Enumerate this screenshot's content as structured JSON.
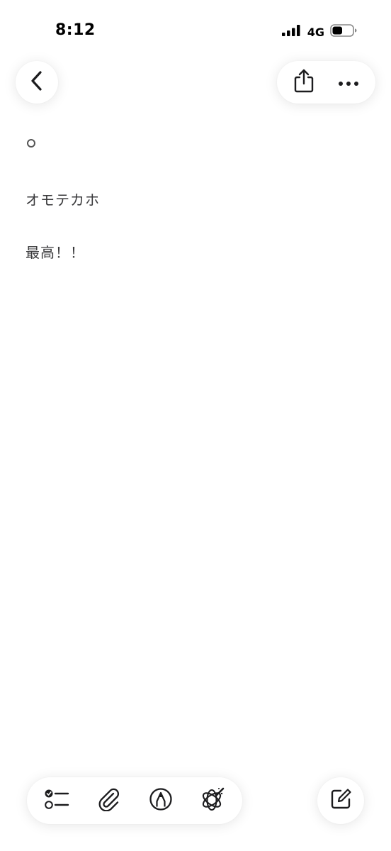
{
  "status_bar": {
    "time": "8:12",
    "network": "4G",
    "battery_level_fraction": 0.5
  },
  "navigation": {
    "back_icon": "chevron-left-icon",
    "share_icon": "share-icon",
    "more_icon": "ellipsis-icon"
  },
  "note": {
    "lines": [
      "オモテカホ",
      "最高！！"
    ]
  },
  "toolbar": {
    "checklist_icon": "checklist-icon",
    "attachment_icon": "paperclip-icon",
    "markup_icon": "pen-circle-icon",
    "writing_tools_icon": "writing-tools-icon",
    "compose_icon": "compose-icon"
  }
}
